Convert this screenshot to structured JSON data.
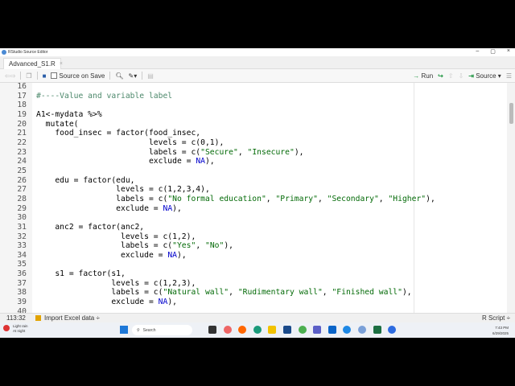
{
  "window": {
    "title": "RStudio Source Editor",
    "minimize": "–",
    "maximize": "▢",
    "close": "×"
  },
  "tab": {
    "label": "Advanced_S1.R",
    "close": "×"
  },
  "toolbar": {
    "source_on_save": "Source on Save",
    "run": "Run",
    "source": "Source"
  },
  "editor": {
    "lines": [
      {
        "n": "16",
        "t": ""
      },
      {
        "n": "17",
        "t": "#----Value and variable label"
      },
      {
        "n": "18",
        "t": ""
      },
      {
        "n": "19",
        "t": "A1<-mydata %>%"
      },
      {
        "n": "20",
        "t": "  mutate("
      },
      {
        "n": "21",
        "t": "    food_insec = factor(food_insec,"
      },
      {
        "n": "22",
        "t": "                        levels = c(0,1),"
      },
      {
        "n": "23",
        "t": "                        labels = c(\"Secure\", \"Insecure\"),"
      },
      {
        "n": "24",
        "t": "                        exclude = NA),"
      },
      {
        "n": "25",
        "t": ""
      },
      {
        "n": "26",
        "t": "    edu = factor(edu,"
      },
      {
        "n": "27",
        "t": "                 levels = c(1,2,3,4),"
      },
      {
        "n": "28",
        "t": "                 labels = c(\"No formal education\", \"Primary\", \"Secondary\", \"Higher\"),"
      },
      {
        "n": "29",
        "t": "                 exclude = NA),"
      },
      {
        "n": "30",
        "t": ""
      },
      {
        "n": "31",
        "t": "    anc2 = factor(anc2,"
      },
      {
        "n": "32",
        "t": "                  levels = c(1,2),"
      },
      {
        "n": "33",
        "t": "                  labels = c(\"Yes\", \"No\"),"
      },
      {
        "n": "34",
        "t": "                  exclude = NA),"
      },
      {
        "n": "35",
        "t": ""
      },
      {
        "n": "36",
        "t": "    s1 = factor(s1,"
      },
      {
        "n": "37",
        "t": "                levels = c(1,2,3),"
      },
      {
        "n": "38",
        "t": "                labels = c(\"Natural wall\", \"Rudimentary wall\", \"Finished wall\"),"
      },
      {
        "n": "39",
        "t": "                exclude = NA),"
      },
      {
        "n": "40",
        "t": ""
      }
    ]
  },
  "status": {
    "position": "113:32",
    "section": "Import Excel data ÷",
    "filetype": "R Script ÷"
  },
  "taskbar": {
    "weather": "Light rain",
    "weather_sub": "At night",
    "badge": "1",
    "search": "Search",
    "time": "7:43 PM",
    "date": "6/29/2025"
  },
  "colors": {
    "string": "#036a07",
    "number": "#0000cd",
    "comment": "#4c886b"
  }
}
